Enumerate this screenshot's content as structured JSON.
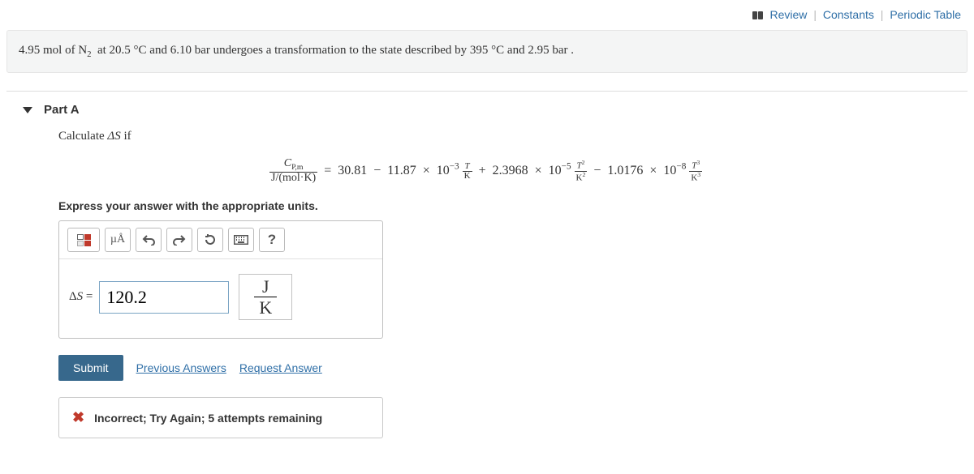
{
  "topLinks": {
    "review": "Review",
    "constants": "Constants",
    "periodic": "Periodic Table"
  },
  "banner": {
    "moles": "4.95",
    "mol": "mol",
    "ofN2_pre": "of",
    "species": "N",
    "sub2": "2",
    "at": "at",
    "t1": "20.5",
    "degC": "C",
    "and": "and",
    "p1": "6.10",
    "bar": "bar",
    "mid": "undergoes a transformation to the state described by",
    "t2": "395",
    "p2": "2.95",
    "period": "."
  },
  "part": {
    "label": "Part A",
    "calc_pre": "Calculate",
    "calc_sym": "ΔS",
    "calc_post": "if",
    "eq": {
      "cp": "C",
      "cpSub": "P,m",
      "denom": "J/(mol·K)",
      "rhs1": "30.81",
      "minus": "−",
      "c2": "11.87",
      "times": "×",
      "ten": "10",
      "e3": "−3",
      "tk_num": "T",
      "tk_den": "K",
      "plus": "+",
      "c3": "2.3968",
      "e5": "−5",
      "t2_num": "T",
      "t2_sup": "2",
      "k2_den": "K",
      "k2_sup": "2",
      "c4": "1.0176",
      "e8": "−8",
      "t3_sup": "3",
      "k3_sup": "3"
    },
    "unitsHint": "Express your answer with the appropriate units.",
    "toolbar": {
      "units": "µÅ",
      "help": "?"
    },
    "answer": {
      "lhs": "ΔS =",
      "value": "120.2",
      "unit_num": "J",
      "unit_den": "K"
    },
    "submit": "Submit",
    "prev": "Previous Answers",
    "request": "Request Answer",
    "feedback": "Incorrect; Try Again; 5 attempts remaining"
  }
}
